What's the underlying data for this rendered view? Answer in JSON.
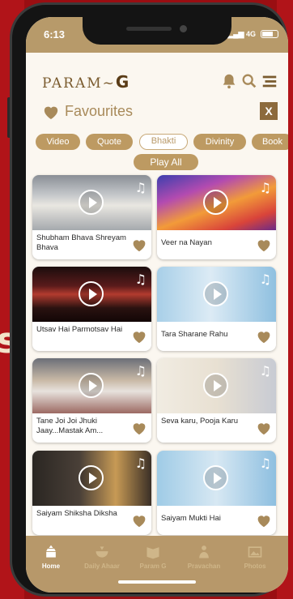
{
  "status": {
    "time": "6:13",
    "network": "4G"
  },
  "app": {
    "logo_left": "PARAM~",
    "logo_right": "G"
  },
  "favourites": {
    "title": "Favourites",
    "close_label": "X"
  },
  "tabs": [
    {
      "label": "Video",
      "active": false
    },
    {
      "label": "Quote",
      "active": false
    },
    {
      "label": "Bhakti",
      "active": true
    },
    {
      "label": "Divinity",
      "active": false
    },
    {
      "label": "Book",
      "active": false
    }
  ],
  "play_all": "Play All",
  "cards": [
    {
      "title": "Shubham Bhava Shreyam Bhava",
      "icon": "music-note-icon"
    },
    {
      "title": "Veer na Nayan",
      "icon": "music-note-icon"
    },
    {
      "title": "Utsav Hai Parmotsav Hai",
      "icon": "music-note-icon"
    },
    {
      "title": "Tara Sharane Rahu",
      "icon": "music-note-icon"
    },
    {
      "title": "Tane Joi Joi Jhuki Jaay...Mastak Am...",
      "icon": "music-note-icon"
    },
    {
      "title": "Seva karu, Pooja Karu",
      "icon": "music-note-icon"
    },
    {
      "title": "Saiyam Shiksha Diksha",
      "icon": "music-note-icon"
    },
    {
      "title": "Saiyam Mukti Hai",
      "icon": "music-note-icon"
    }
  ],
  "nav": [
    {
      "label": "Home",
      "icon": "temple-icon",
      "active": true
    },
    {
      "label": "Daily Ahaar",
      "icon": "bowl-icon",
      "active": false
    },
    {
      "label": "Param G",
      "icon": "book-icon",
      "active": false
    },
    {
      "label": "Pravachan",
      "icon": "speaker-icon",
      "active": false
    },
    {
      "label": "Photos",
      "icon": "photo-icon",
      "active": false
    }
  ],
  "colors": {
    "accent": "#b7986a",
    "brand_dark": "#7a5b2e",
    "background": "#9a0e12"
  }
}
